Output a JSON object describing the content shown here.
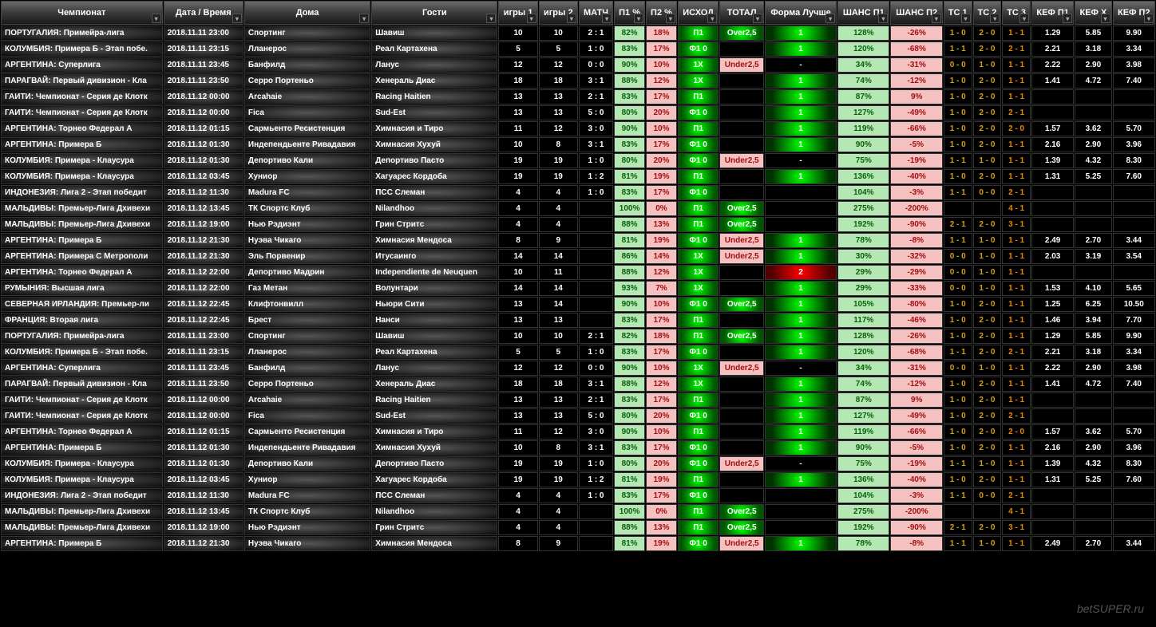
{
  "watermark": "betSUPER.ru",
  "headers": [
    {
      "label": "Чемпионат",
      "cls": "wide"
    },
    {
      "label": "Дата / Время",
      "cls": "med"
    },
    {
      "label": "Дома",
      "cls": "wide"
    },
    {
      "label": "Гости",
      "cls": "wide"
    },
    {
      "label": "игры 1"
    },
    {
      "label": "игры 2"
    },
    {
      "label": "МАТЧ"
    },
    {
      "label": "П1 %"
    },
    {
      "label": "П2 %"
    },
    {
      "label": "ИСХОД"
    },
    {
      "label": "ТОТАЛ"
    },
    {
      "label": "Форма Лучше"
    },
    {
      "label": "ШАНС П1"
    },
    {
      "label": "ШАНС П2"
    },
    {
      "label": "ТС 1"
    },
    {
      "label": "ТС 2"
    },
    {
      "label": "ТС 3"
    },
    {
      "label": "КЕФ П1"
    },
    {
      "label": "КЕФ X"
    },
    {
      "label": "КЕФ П2"
    }
  ],
  "rows": [
    {
      "champ": "ПОРТУГАЛИЯ: Примейра-лига",
      "dt": "2018.11.11 23:00",
      "home": "Спортинг",
      "away": "Шавиш",
      "g1": "10",
      "g2": "10",
      "m": "2 : 1",
      "p1": "82%",
      "p2": "18%",
      "out": "П1",
      "tot": "Over2,5",
      "f": "1",
      "fc": "g",
      "s1": "128%",
      "s2": "-26%",
      "t1": "1 - 0",
      "t2": "2 - 0",
      "t3": "1 - 1",
      "k1": "1.29",
      "kx": "5.85",
      "k2": "9.90"
    },
    {
      "champ": "КОЛУМБИЯ: Примера Б - Этап побе.",
      "dt": "2018.11.11 23:15",
      "home": "Лланерос",
      "away": "Реал Картахена",
      "g1": "5",
      "g2": "5",
      "m": "1 : 0",
      "p1": "83%",
      "p2": "17%",
      "out": "Ф1 0",
      "tot": "",
      "f": "1",
      "fc": "g",
      "s1": "120%",
      "s2": "-68%",
      "t1": "1 - 1",
      "t2": "2 - 0",
      "t3": "2 - 1",
      "k1": "2.21",
      "kx": "3.18",
      "k2": "3.34"
    },
    {
      "champ": "АРГЕНТИНА: Суперлига",
      "dt": "2018.11.11 23:45",
      "home": "Банфилд",
      "away": "Ланус",
      "g1": "12",
      "g2": "12",
      "m": "0 : 0",
      "p1": "90%",
      "p2": "10%",
      "out": "1X",
      "tot": "Under2,5",
      "f": "-",
      "fc": "",
      "s1": "34%",
      "s2": "-31%",
      "t1": "0 - 0",
      "t2": "1 - 0",
      "t3": "1 - 1",
      "k1": "2.22",
      "kx": "2.90",
      "k2": "3.98"
    },
    {
      "champ": "ПАРАГВАЙ: Первый дивизион - Кла",
      "dt": "2018.11.11 23:50",
      "home": "Серро Портеньо",
      "away": "Хенераль Диас",
      "g1": "18",
      "g2": "18",
      "m": "3 : 1",
      "p1": "88%",
      "p2": "12%",
      "out": "1X",
      "tot": "",
      "f": "1",
      "fc": "g",
      "s1": "74%",
      "s2": "-12%",
      "t1": "1 - 0",
      "t2": "2 - 0",
      "t3": "1 - 1",
      "k1": "1.41",
      "kx": "4.72",
      "k2": "7.40"
    },
    {
      "champ": "ГАИТИ: Чемпионат - Серия де Клотк",
      "dt": "2018.11.12 00:00",
      "home": "Arcahaie",
      "away": "Racing Haitien",
      "g1": "13",
      "g2": "13",
      "m": "2 : 1",
      "p1": "83%",
      "p2": "17%",
      "out": "П1",
      "tot": "",
      "f": "1",
      "fc": "g",
      "s1": "87%",
      "s2": "9%",
      "t1": "1 - 0",
      "t2": "2 - 0",
      "t3": "1 - 1",
      "k1": "",
      "kx": "",
      "k2": ""
    },
    {
      "champ": "ГАИТИ: Чемпионат - Серия де Клотк",
      "dt": "2018.11.12 00:00",
      "home": "Fica",
      "away": "Sud-Est",
      "g1": "13",
      "g2": "13",
      "m": "5 : 0",
      "p1": "80%",
      "p2": "20%",
      "out": "Ф1 0",
      "tot": "",
      "f": "1",
      "fc": "g",
      "s1": "127%",
      "s2": "-49%",
      "t1": "1 - 0",
      "t2": "2 - 0",
      "t3": "2 - 1",
      "k1": "",
      "kx": "",
      "k2": ""
    },
    {
      "champ": "АРГЕНТИНА: Торнео Федерал А",
      "dt": "2018.11.12 01:15",
      "home": "Сармьенто Ресистенция",
      "away": "Химнасия и Тиро",
      "g1": "11",
      "g2": "12",
      "m": "3 : 0",
      "p1": "90%",
      "p2": "10%",
      "out": "П1",
      "tot": "",
      "f": "1",
      "fc": "g",
      "s1": "119%",
      "s2": "-66%",
      "t1": "1 - 0",
      "t2": "2 - 0",
      "t3": "2 - 0",
      "k1": "1.57",
      "kx": "3.62",
      "k2": "5.70"
    },
    {
      "champ": "АРГЕНТИНА: Примера Б",
      "dt": "2018.11.12 01:30",
      "home": "Индепендьенте Ривадавия",
      "away": "Химнасия Хухуй",
      "g1": "10",
      "g2": "8",
      "m": "3 : 1",
      "p1": "83%",
      "p2": "17%",
      "out": "Ф1 0",
      "tot": "",
      "f": "1",
      "fc": "g",
      "s1": "90%",
      "s2": "-5%",
      "t1": "1 - 0",
      "t2": "2 - 0",
      "t3": "1 - 1",
      "k1": "2.16",
      "kx": "2.90",
      "k2": "3.96"
    },
    {
      "champ": "КОЛУМБИЯ: Примера - Клаусура",
      "dt": "2018.11.12 01:30",
      "home": "Депортиво Кали",
      "away": "Депортиво Пасто",
      "g1": "19",
      "g2": "19",
      "m": "1 : 0",
      "p1": "80%",
      "p2": "20%",
      "out": "Ф1 0",
      "tot": "Under2,5",
      "f": "-",
      "fc": "",
      "s1": "75%",
      "s2": "-19%",
      "t1": "1 - 1",
      "t2": "1 - 0",
      "t3": "1 - 1",
      "k1": "1.39",
      "kx": "4.32",
      "k2": "8.30"
    },
    {
      "champ": "КОЛУМБИЯ: Примера - Клаусура",
      "dt": "2018.11.12 03:45",
      "home": "Хуниор",
      "away": "Хагуарес Кордоба",
      "g1": "19",
      "g2": "19",
      "m": "1 : 2",
      "p1": "81%",
      "p2": "19%",
      "out": "П1",
      "tot": "",
      "f": "1",
      "fc": "g",
      "s1": "136%",
      "s2": "-40%",
      "t1": "1 - 0",
      "t2": "2 - 0",
      "t3": "1 - 1",
      "k1": "1.31",
      "kx": "5.25",
      "k2": "7.60"
    },
    {
      "champ": "ИНДОНЕЗИЯ: Лига 2 - Этап победит",
      "dt": "2018.11.12 11:30",
      "home": "Madura FC",
      "away": "ПСС Слеман",
      "g1": "4",
      "g2": "4",
      "m": "1 : 0",
      "p1": "83%",
      "p2": "17%",
      "out": "Ф1 0",
      "tot": "",
      "f": "",
      "fc": "",
      "s1": "104%",
      "s2": "-3%",
      "t1": "1 - 1",
      "t2": "0 - 0",
      "t3": "2 - 1",
      "k1": "",
      "kx": "",
      "k2": ""
    },
    {
      "champ": "МАЛЬДИВЫ: Премьер-Лига Дхивехи",
      "dt": "2018.11.12 13:45",
      "home": "ТК Спортс Клуб",
      "away": "Nilandhoo",
      "g1": "4",
      "g2": "4",
      "m": "",
      "p1": "100%",
      "p2": "0%",
      "out": "П1",
      "tot": "Over2,5",
      "f": "",
      "fc": "",
      "s1": "275%",
      "s2": "-200%",
      "t1": "",
      "t2": "",
      "t3": "4 - 1",
      "k1": "",
      "kx": "",
      "k2": ""
    },
    {
      "champ": "МАЛЬДИВЫ: Премьер-Лига Дхивехи",
      "dt": "2018.11.12 19:00",
      "home": "Нью Рэдиэнт",
      "away": "Грин Стритс",
      "g1": "4",
      "g2": "4",
      "m": "",
      "p1": "88%",
      "p2": "13%",
      "out": "П1",
      "tot": "Over2,5",
      "f": "",
      "fc": "",
      "s1": "192%",
      "s2": "-90%",
      "t1": "2 - 1",
      "t2": "2 - 0",
      "t3": "3 - 1",
      "k1": "",
      "kx": "",
      "k2": ""
    },
    {
      "champ": "АРГЕНТИНА: Примера Б",
      "dt": "2018.11.12 21:30",
      "home": "Нуэва Чикаго",
      "away": "Химнасия Мендоса",
      "g1": "8",
      "g2": "9",
      "m": "",
      "p1": "81%",
      "p2": "19%",
      "out": "Ф1 0",
      "tot": "Under2,5",
      "f": "1",
      "fc": "g",
      "s1": "78%",
      "s2": "-8%",
      "t1": "1 - 1",
      "t2": "1 - 0",
      "t3": "1 - 1",
      "k1": "2.49",
      "kx": "2.70",
      "k2": "3.44"
    },
    {
      "champ": "АРГЕНТИНА: Примера С Метрополи",
      "dt": "2018.11.12 21:30",
      "home": "Эль Порвенир",
      "away": "Итусаинго",
      "g1": "14",
      "g2": "14",
      "m": "",
      "p1": "86%",
      "p2": "14%",
      "out": "1X",
      "tot": "Under2,5",
      "f": "1",
      "fc": "g",
      "s1": "30%",
      "s2": "-32%",
      "t1": "0 - 0",
      "t2": "1 - 0",
      "t3": "1 - 1",
      "k1": "2.03",
      "kx": "3.19",
      "k2": "3.54"
    },
    {
      "champ": "АРГЕНТИНА: Торнео Федерал А",
      "dt": "2018.11.12 22:00",
      "home": "Депортиво Мадрин",
      "away": "Independiente de Neuquen",
      "g1": "10",
      "g2": "11",
      "m": "",
      "p1": "88%",
      "p2": "12%",
      "out": "1X",
      "tot": "",
      "f": "2",
      "fc": "r",
      "s1": "29%",
      "s2": "-29%",
      "t1": "0 - 0",
      "t2": "1 - 0",
      "t3": "1 - 1",
      "k1": "",
      "kx": "",
      "k2": ""
    },
    {
      "champ": "РУМЫНИЯ: Высшая лига",
      "dt": "2018.11.12 22:00",
      "home": "Газ Метан",
      "away": "Волунтари",
      "g1": "14",
      "g2": "14",
      "m": "",
      "p1": "93%",
      "p2": "7%",
      "out": "1X",
      "tot": "",
      "f": "1",
      "fc": "g",
      "s1": "29%",
      "s2": "-33%",
      "t1": "0 - 0",
      "t2": "1 - 0",
      "t3": "1 - 1",
      "k1": "1.53",
      "kx": "4.10",
      "k2": "5.65"
    },
    {
      "champ": "СЕВЕРНАЯ ИРЛАНДИЯ: Премьер-ли",
      "dt": "2018.11.12 22:45",
      "home": "Клифтонвилл",
      "away": "Ньюри Сити",
      "g1": "13",
      "g2": "14",
      "m": "",
      "p1": "90%",
      "p2": "10%",
      "out": "Ф1 0",
      "tot": "Over2,5",
      "f": "1",
      "fc": "g",
      "s1": "105%",
      "s2": "-80%",
      "t1": "1 - 0",
      "t2": "2 - 0",
      "t3": "1 - 1",
      "k1": "1.25",
      "kx": "6.25",
      "k2": "10.50"
    },
    {
      "champ": "ФРАНЦИЯ: Вторая лига",
      "dt": "2018.11.12 22:45",
      "home": "Брест",
      "away": "Нанси",
      "g1": "13",
      "g2": "13",
      "m": "",
      "p1": "83%",
      "p2": "17%",
      "out": "П1",
      "tot": "",
      "f": "1",
      "fc": "g",
      "s1": "117%",
      "s2": "-46%",
      "t1": "1 - 0",
      "t2": "2 - 0",
      "t3": "1 - 1",
      "k1": "1.46",
      "kx": "3.94",
      "k2": "7.70"
    },
    {
      "champ": "ПОРТУГАЛИЯ: Примейра-лига",
      "dt": "2018.11.11 23:00",
      "home": "Спортинг",
      "away": "Шавиш",
      "g1": "10",
      "g2": "10",
      "m": "2 : 1",
      "p1": "82%",
      "p2": "18%",
      "out": "П1",
      "tot": "Over2,5",
      "f": "1",
      "fc": "g",
      "s1": "128%",
      "s2": "-26%",
      "t1": "1 - 0",
      "t2": "2 - 0",
      "t3": "1 - 1",
      "k1": "1.29",
      "kx": "5.85",
      "k2": "9.90"
    },
    {
      "champ": "КОЛУМБИЯ: Примера Б - Этап побе.",
      "dt": "2018.11.11 23:15",
      "home": "Лланерос",
      "away": "Реал Картахена",
      "g1": "5",
      "g2": "5",
      "m": "1 : 0",
      "p1": "83%",
      "p2": "17%",
      "out": "Ф1 0",
      "tot": "",
      "f": "1",
      "fc": "g",
      "s1": "120%",
      "s2": "-68%",
      "t1": "1 - 1",
      "t2": "2 - 0",
      "t3": "2 - 1",
      "k1": "2.21",
      "kx": "3.18",
      "k2": "3.34"
    },
    {
      "champ": "АРГЕНТИНА: Суперлига",
      "dt": "2018.11.11 23:45",
      "home": "Банфилд",
      "away": "Ланус",
      "g1": "12",
      "g2": "12",
      "m": "0 : 0",
      "p1": "90%",
      "p2": "10%",
      "out": "1X",
      "tot": "Under2,5",
      "f": "-",
      "fc": "",
      "s1": "34%",
      "s2": "-31%",
      "t1": "0 - 0",
      "t2": "1 - 0",
      "t3": "1 - 1",
      "k1": "2.22",
      "kx": "2.90",
      "k2": "3.98"
    },
    {
      "champ": "ПАРАГВАЙ: Первый дивизион - Кла",
      "dt": "2018.11.11 23:50",
      "home": "Серро Портеньо",
      "away": "Хенераль Диас",
      "g1": "18",
      "g2": "18",
      "m": "3 : 1",
      "p1": "88%",
      "p2": "12%",
      "out": "1X",
      "tot": "",
      "f": "1",
      "fc": "g",
      "s1": "74%",
      "s2": "-12%",
      "t1": "1 - 0",
      "t2": "2 - 0",
      "t3": "1 - 1",
      "k1": "1.41",
      "kx": "4.72",
      "k2": "7.40"
    },
    {
      "champ": "ГАИТИ: Чемпионат - Серия де Клотк",
      "dt": "2018.11.12 00:00",
      "home": "Arcahaie",
      "away": "Racing Haitien",
      "g1": "13",
      "g2": "13",
      "m": "2 : 1",
      "p1": "83%",
      "p2": "17%",
      "out": "П1",
      "tot": "",
      "f": "1",
      "fc": "g",
      "s1": "87%",
      "s2": "9%",
      "t1": "1 - 0",
      "t2": "2 - 0",
      "t3": "1 - 1",
      "k1": "",
      "kx": "",
      "k2": ""
    },
    {
      "champ": "ГАИТИ: Чемпионат - Серия де Клотк",
      "dt": "2018.11.12 00:00",
      "home": "Fica",
      "away": "Sud-Est",
      "g1": "13",
      "g2": "13",
      "m": "5 : 0",
      "p1": "80%",
      "p2": "20%",
      "out": "Ф1 0",
      "tot": "",
      "f": "1",
      "fc": "g",
      "s1": "127%",
      "s2": "-49%",
      "t1": "1 - 0",
      "t2": "2 - 0",
      "t3": "2 - 1",
      "k1": "",
      "kx": "",
      "k2": ""
    },
    {
      "champ": "АРГЕНТИНА: Торнео Федерал А",
      "dt": "2018.11.12 01:15",
      "home": "Сармьенто Ресистенция",
      "away": "Химнасия и Тиро",
      "g1": "11",
      "g2": "12",
      "m": "3 : 0",
      "p1": "90%",
      "p2": "10%",
      "out": "П1",
      "tot": "",
      "f": "1",
      "fc": "g",
      "s1": "119%",
      "s2": "-66%",
      "t1": "1 - 0",
      "t2": "2 - 0",
      "t3": "2 - 0",
      "k1": "1.57",
      "kx": "3.62",
      "k2": "5.70"
    },
    {
      "champ": "АРГЕНТИНА: Примера Б",
      "dt": "2018.11.12 01:30",
      "home": "Индепендьенте Ривадавия",
      "away": "Химнасия Хухуй",
      "g1": "10",
      "g2": "8",
      "m": "3 : 1",
      "p1": "83%",
      "p2": "17%",
      "out": "Ф1 0",
      "tot": "",
      "f": "1",
      "fc": "g",
      "s1": "90%",
      "s2": "-5%",
      "t1": "1 - 0",
      "t2": "2 - 0",
      "t3": "1 - 1",
      "k1": "2.16",
      "kx": "2.90",
      "k2": "3.96"
    },
    {
      "champ": "КОЛУМБИЯ: Примера - Клаусура",
      "dt": "2018.11.12 01:30",
      "home": "Депортиво Кали",
      "away": "Депортиво Пасто",
      "g1": "19",
      "g2": "19",
      "m": "1 : 0",
      "p1": "80%",
      "p2": "20%",
      "out": "Ф1 0",
      "tot": "Under2,5",
      "f": "-",
      "fc": "",
      "s1": "75%",
      "s2": "-19%",
      "t1": "1 - 1",
      "t2": "1 - 0",
      "t3": "1 - 1",
      "k1": "1.39",
      "kx": "4.32",
      "k2": "8.30"
    },
    {
      "champ": "КОЛУМБИЯ: Примера - Клаусура",
      "dt": "2018.11.12 03:45",
      "home": "Хуниор",
      "away": "Хагуарес Кордоба",
      "g1": "19",
      "g2": "19",
      "m": "1 : 2",
      "p1": "81%",
      "p2": "19%",
      "out": "П1",
      "tot": "",
      "f": "1",
      "fc": "g",
      "s1": "136%",
      "s2": "-40%",
      "t1": "1 - 0",
      "t2": "2 - 0",
      "t3": "1 - 1",
      "k1": "1.31",
      "kx": "5.25",
      "k2": "7.60"
    },
    {
      "champ": "ИНДОНЕЗИЯ: Лига 2 - Этап победит",
      "dt": "2018.11.12 11:30",
      "home": "Madura FC",
      "away": "ПСС Слеман",
      "g1": "4",
      "g2": "4",
      "m": "1 : 0",
      "p1": "83%",
      "p2": "17%",
      "out": "Ф1 0",
      "tot": "",
      "f": "",
      "fc": "",
      "s1": "104%",
      "s2": "-3%",
      "t1": "1 - 1",
      "t2": "0 - 0",
      "t3": "2 - 1",
      "k1": "",
      "kx": "",
      "k2": ""
    },
    {
      "champ": "МАЛЬДИВЫ: Премьер-Лига Дхивехи",
      "dt": "2018.11.12 13:45",
      "home": "ТК Спортс Клуб",
      "away": "Nilandhoo",
      "g1": "4",
      "g2": "4",
      "m": "",
      "p1": "100%",
      "p2": "0%",
      "out": "П1",
      "tot": "Over2,5",
      "f": "",
      "fc": "",
      "s1": "275%",
      "s2": "-200%",
      "t1": "",
      "t2": "",
      "t3": "4 - 1",
      "k1": "",
      "kx": "",
      "k2": ""
    },
    {
      "champ": "МАЛЬДИВЫ: Премьер-Лига Дхивехи",
      "dt": "2018.11.12 19:00",
      "home": "Нью Рэдиэнт",
      "away": "Грин Стритс",
      "g1": "4",
      "g2": "4",
      "m": "",
      "p1": "88%",
      "p2": "13%",
      "out": "П1",
      "tot": "Over2,5",
      "f": "",
      "fc": "",
      "s1": "192%",
      "s2": "-90%",
      "t1": "2 - 1",
      "t2": "2 - 0",
      "t3": "3 - 1",
      "k1": "",
      "kx": "",
      "k2": ""
    },
    {
      "champ": "АРГЕНТИНА: Примера Б",
      "dt": "2018.11.12 21:30",
      "home": "Нуэва Чикаго",
      "away": "Химнасия Мендоса",
      "g1": "8",
      "g2": "9",
      "m": "",
      "p1": "81%",
      "p2": "19%",
      "out": "Ф1 0",
      "tot": "Under2,5",
      "f": "1",
      "fc": "g",
      "s1": "78%",
      "s2": "-8%",
      "t1": "1 - 1",
      "t2": "1 - 0",
      "t3": "1 - 1",
      "k1": "2.49",
      "kx": "2.70",
      "k2": "3.44"
    }
  ]
}
